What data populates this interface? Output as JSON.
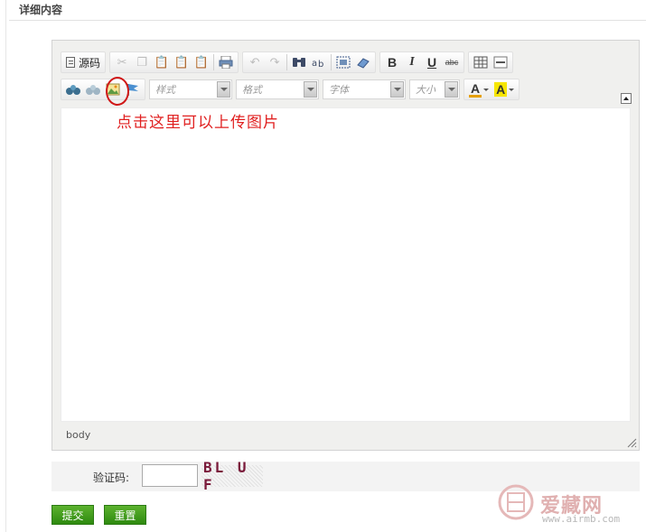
{
  "section": {
    "title": "详细内容"
  },
  "editor": {
    "toolbar": {
      "source_label": "源码",
      "style_combo": "样式",
      "format_combo": "格式",
      "font_combo": "字体",
      "size_combo": "大小",
      "bold": "B",
      "italic": "I",
      "underline": "U",
      "strike": "abc",
      "text_color": "A",
      "bg_color": "A"
    },
    "hint": "点击这里可以上传图片",
    "status_path": "body"
  },
  "form": {
    "captcha_label": "验证码:",
    "captcha_value": "",
    "captcha_image_text": "BL U F",
    "submit_label": "提交",
    "reset_label": "重置"
  },
  "watermark": {
    "brand": "爱藏网",
    "url": "www.airmb.com"
  },
  "colors": {
    "hint_red": "#e02020",
    "button_green": "#3f9a1e",
    "editor_bg": "#f0f0ee"
  }
}
